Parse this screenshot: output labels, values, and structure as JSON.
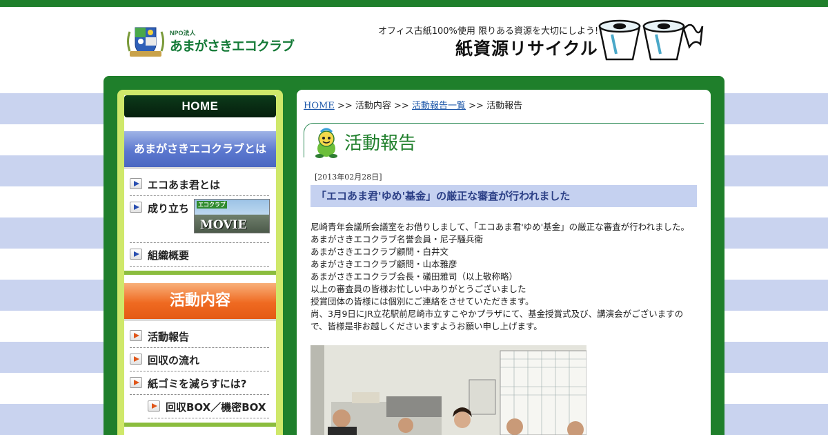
{
  "header": {
    "logo_npo": "NPO法人",
    "logo_name": "あまがさきエコクラブ",
    "tagline": "オフィス古紙100%使用 限りある資源を大切にしよう!",
    "headline": "紙資源リサイクル"
  },
  "sidebar": {
    "home_label": "HOME",
    "about_header": "あまがさきエコクラブとは",
    "about_items": [
      {
        "label": "エコあま君とは"
      },
      {
        "label": "成り立ち"
      },
      {
        "label": "組織概要"
      }
    ],
    "movie_tag": "エコクラブ",
    "movie_label": "MOVIE",
    "activity_header": "活動内容",
    "activity_items": [
      {
        "label": "活動報告"
      },
      {
        "label": "回収の流れ"
      },
      {
        "label": "紙ゴミを減らすには?"
      },
      {
        "label": "回収BOX／機密BOX"
      }
    ]
  },
  "main": {
    "breadcrumb": {
      "home": "HOME",
      "sep": ">>",
      "level1": "活動内容",
      "level2": "活動報告一覧",
      "current": "活動報告"
    },
    "page_title": "活動報告",
    "post": {
      "date": "[2013年02月28日]",
      "title": "「エコあま君'ゆめ'基金」の厳正な審査が行われました",
      "lines": [
        "尼崎青年会議所会議室をお借りしまして、「エコあま君'ゆめ'基金」の厳正な審査が行われました。",
        "あまがさきエコクラブ名誉会員・尼子騒兵衛",
        "あまがさきエコクラブ顧問・白井文",
        "あまがさきエコクラブ顧問・山本雅彦",
        "あまがさきエコクラブ会長・礒田雅司（以上敬称略）",
        "以上の審査員の皆様お忙しい中ありがとうございました",
        "授賞団体の皆様には個別にご連絡をさせていただきます。",
        "尚、3月9日にJR立花駅前尼崎市立すこやかプラザにて、基金授賞式及び、講演会がございますので、皆様是非お越しくださいますようお願い申し上げます。"
      ]
    }
  },
  "colors": {
    "frame_green": "#1f7f2b",
    "sidebar_lime": "#cfe86a",
    "stripe_blue": "#c9d3ef",
    "title_green": "#1f7f2b",
    "post_title_bg": "#c5d1f0",
    "about_blue": "#5c78cf",
    "activity_orange": "#ef6a21"
  }
}
